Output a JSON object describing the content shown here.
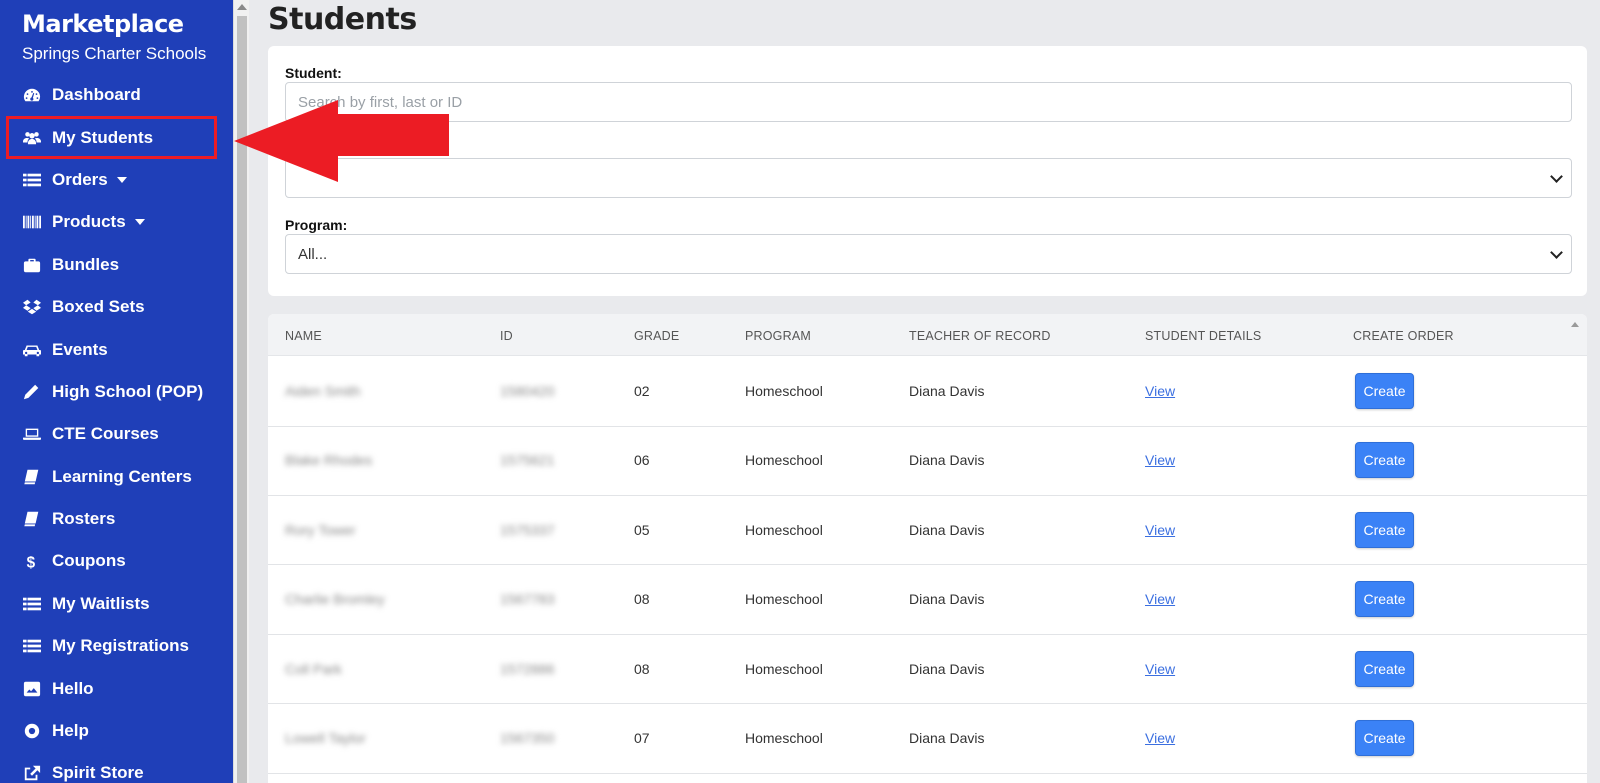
{
  "sidebar": {
    "brand": "Marketplace",
    "subtitle": "Springs Charter Schools",
    "items": [
      {
        "label": "Dashboard",
        "icon": "dashboard-icon",
        "caret": false
      },
      {
        "label": "My Students",
        "icon": "users-icon",
        "caret": false,
        "highlighted": true
      },
      {
        "label": "Orders",
        "icon": "list-icon",
        "caret": true
      },
      {
        "label": "Products",
        "icon": "barcode-icon",
        "caret": true
      },
      {
        "label": "Bundles",
        "icon": "briefcase-icon",
        "caret": false
      },
      {
        "label": "Boxed Sets",
        "icon": "dropbox-icon",
        "caret": false
      },
      {
        "label": "Events",
        "icon": "car-icon",
        "caret": false
      },
      {
        "label": "High School (POP)",
        "icon": "pencil-icon",
        "caret": false
      },
      {
        "label": "CTE Courses",
        "icon": "laptop-icon",
        "caret": false
      },
      {
        "label": "Learning Centers",
        "icon": "book-icon",
        "caret": false
      },
      {
        "label": "Rosters",
        "icon": "book-icon",
        "caret": false
      },
      {
        "label": "Coupons",
        "icon": "dollar-icon",
        "caret": false
      },
      {
        "label": "My Waitlists",
        "icon": "list-icon",
        "caret": false
      },
      {
        "label": "My Registrations",
        "icon": "list-icon",
        "caret": false
      },
      {
        "label": "Hello",
        "icon": "image-icon",
        "caret": false
      },
      {
        "label": "Help",
        "icon": "lifering-icon",
        "caret": false
      },
      {
        "label": "Spirit Store",
        "icon": "external-link-icon",
        "caret": false
      }
    ]
  },
  "main": {
    "title": "Students",
    "filters": {
      "student_label": "Student:",
      "student_placeholder": "Search by first, last or ID",
      "second_select_value": "",
      "program_label": "Program:",
      "program_value": "All..."
    },
    "table": {
      "headers": [
        "NAME",
        "ID",
        "GRADE",
        "PROGRAM",
        "TEACHER OF RECORD",
        "STUDENT DETAILS",
        "CREATE ORDER"
      ],
      "rows": [
        {
          "name": "Aiden Smith",
          "id": "1580420",
          "grade": "02",
          "program": "Homeschool",
          "teacher": "Diana Davis",
          "details": "View",
          "action": "Create"
        },
        {
          "name": "Blake Rhodes",
          "id": "1575621",
          "grade": "06",
          "program": "Homeschool",
          "teacher": "Diana Davis",
          "details": "View",
          "action": "Create"
        },
        {
          "name": "Rory Tower",
          "id": "1575337",
          "grade": "05",
          "program": "Homeschool",
          "teacher": "Diana Davis",
          "details": "View",
          "action": "Create"
        },
        {
          "name": "Charlie Bromley",
          "id": "1567783",
          "grade": "08",
          "program": "Homeschool",
          "teacher": "Diana Davis",
          "details": "View",
          "action": "Create"
        },
        {
          "name": "Coll Park",
          "id": "1572886",
          "grade": "08",
          "program": "Homeschool",
          "teacher": "Diana Davis",
          "details": "View",
          "action": "Create"
        },
        {
          "name": "Lowell Taylor",
          "id": "1567350",
          "grade": "07",
          "program": "Homeschool",
          "teacher": "Diana Davis",
          "details": "View",
          "action": "Create"
        }
      ]
    }
  },
  "colors": {
    "sidebar_bg": "#1f3fb8",
    "highlight_outline": "#ec1c24",
    "arrow": "#ec1c24",
    "create_button": "#3b82f6",
    "link": "#3b6fe0"
  }
}
